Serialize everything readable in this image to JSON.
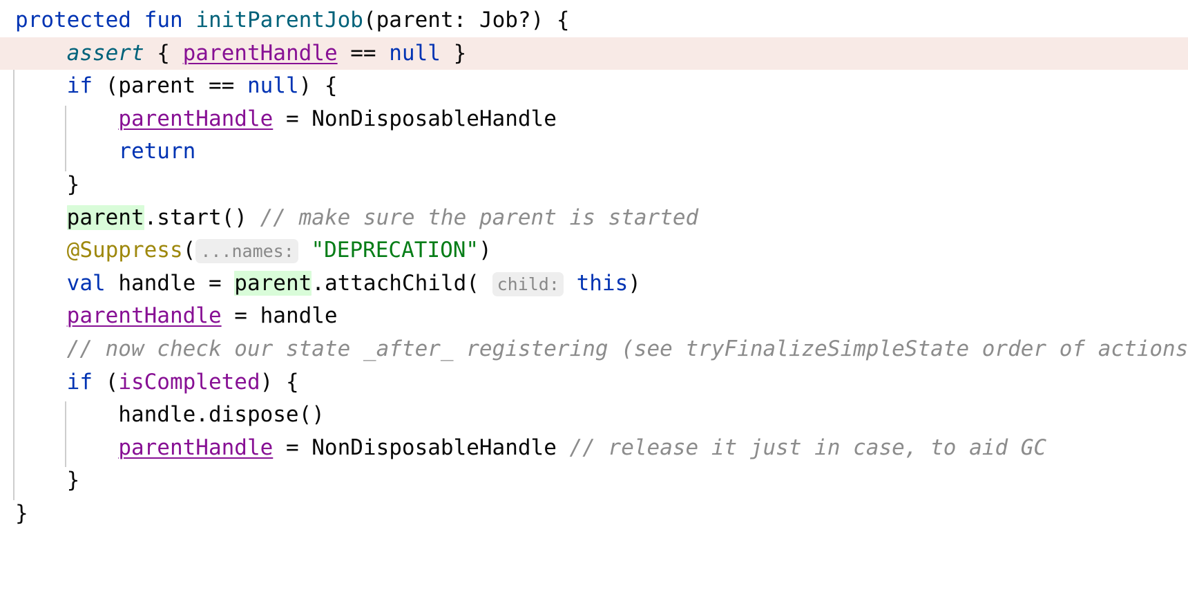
{
  "editor": {
    "language": "Kotlin",
    "theme": "IntelliJ Light",
    "colors": {
      "background": "#ffffff",
      "default_text": "#080808",
      "keyword": "#0033b3",
      "function_declaration": "#00627a",
      "property": "#871094",
      "annotation": "#9e880d",
      "string": "#067d17",
      "comment": "#8c8c8c",
      "usage_highlight": "#d9fcd9",
      "error_line_highlight": "#f8eae6",
      "inlay_hint_text": "#888888",
      "inlay_hint_background": "#eeeeee",
      "indent_guide": "#cdcdcd"
    },
    "lines": [
      {
        "n": 1,
        "text": "protected fun initParentJob(parent: Job?) {",
        "tokens": [
          {
            "t": "protected",
            "c": "kw"
          },
          {
            "t": " ",
            "c": "plain"
          },
          {
            "t": "fun",
            "c": "kw"
          },
          {
            "t": " ",
            "c": "plain"
          },
          {
            "t": "initParentJob",
            "c": "fnname"
          },
          {
            "t": "(parent: Job?) {",
            "c": "plain"
          }
        ]
      },
      {
        "n": 2,
        "text": "    assert { parentHandle == null }",
        "highlight": "error-line",
        "tokens": [
          {
            "t": "    ",
            "c": "plain"
          },
          {
            "t": "assert",
            "c": "contract"
          },
          {
            "t": " { ",
            "c": "plain"
          },
          {
            "t": "parentHandle",
            "c": "field"
          },
          {
            "t": " == ",
            "c": "plain"
          },
          {
            "t": "null",
            "c": "kw"
          },
          {
            "t": " }",
            "c": "plain"
          }
        ]
      },
      {
        "n": 3,
        "text": "    if (parent == null) {",
        "tokens": [
          {
            "t": "    ",
            "c": "plain"
          },
          {
            "t": "if",
            "c": "kw"
          },
          {
            "t": " (parent == ",
            "c": "plain"
          },
          {
            "t": "null",
            "c": "kw"
          },
          {
            "t": ") {",
            "c": "plain"
          }
        ]
      },
      {
        "n": 4,
        "text": "        parentHandle = NonDisposableHandle",
        "tokens": [
          {
            "t": "        ",
            "c": "plain"
          },
          {
            "t": "parentHandle",
            "c": "field"
          },
          {
            "t": " = NonDisposableHandle",
            "c": "plain"
          }
        ]
      },
      {
        "n": 5,
        "text": "        return",
        "tokens": [
          {
            "t": "        ",
            "c": "plain"
          },
          {
            "t": "return",
            "c": "kw"
          }
        ]
      },
      {
        "n": 6,
        "text": "    }",
        "tokens": [
          {
            "t": "    }",
            "c": "plain"
          }
        ]
      },
      {
        "n": 7,
        "text": "    parent.start() // make sure the parent is started",
        "tokens": [
          {
            "t": "    ",
            "c": "plain"
          },
          {
            "t": "parent",
            "c": "plain usage"
          },
          {
            "t": ".start() ",
            "c": "plain"
          },
          {
            "t": "// make sure the parent is started",
            "c": "cmt"
          }
        ]
      },
      {
        "n": 8,
        "text": "    @Suppress( ...names: \"DEPRECATION\")",
        "tokens": [
          {
            "t": "    ",
            "c": "plain"
          },
          {
            "t": "@Suppress",
            "c": "ann"
          },
          {
            "t": "(",
            "c": "plain"
          },
          {
            "t": "...names:",
            "c": "hint"
          },
          {
            "t": " ",
            "c": "plain"
          },
          {
            "t": "\"DEPRECATION\"",
            "c": "str"
          },
          {
            "t": ")",
            "c": "plain"
          }
        ]
      },
      {
        "n": 9,
        "text": "    val handle = parent.attachChild( child: this)",
        "tokens": [
          {
            "t": "    ",
            "c": "plain"
          },
          {
            "t": "val",
            "c": "kw"
          },
          {
            "t": " handle = ",
            "c": "plain"
          },
          {
            "t": "parent",
            "c": "plain usage"
          },
          {
            "t": ".attachChild(",
            "c": "plain"
          },
          {
            "t": " ",
            "c": "plain"
          },
          {
            "t": "child:",
            "c": "hint"
          },
          {
            "t": " ",
            "c": "plain"
          },
          {
            "t": "this",
            "c": "kw"
          },
          {
            "t": ")",
            "c": "plain"
          }
        ]
      },
      {
        "n": 10,
        "text": "    parentHandle = handle",
        "tokens": [
          {
            "t": "    ",
            "c": "plain"
          },
          {
            "t": "parentHandle",
            "c": "field"
          },
          {
            "t": " = handle",
            "c": "plain"
          }
        ]
      },
      {
        "n": 11,
        "text": "    // now check our state _after_ registering (see tryFinalizeSimpleState order of actions)",
        "tokens": [
          {
            "t": "    ",
            "c": "plain"
          },
          {
            "t": "// now check our state _after_ registering (see tryFinalizeSimpleState order of actions)",
            "c": "cmt"
          }
        ]
      },
      {
        "n": 12,
        "text": "    if (isCompleted) {",
        "tokens": [
          {
            "t": "    ",
            "c": "plain"
          },
          {
            "t": "if",
            "c": "kw"
          },
          {
            "t": " (",
            "c": "plain"
          },
          {
            "t": "isCompleted",
            "c": "prop"
          },
          {
            "t": ") {",
            "c": "plain"
          }
        ]
      },
      {
        "n": 13,
        "text": "        handle.dispose()",
        "tokens": [
          {
            "t": "        handle.dispose()",
            "c": "plain"
          }
        ]
      },
      {
        "n": 14,
        "text": "        parentHandle = NonDisposableHandle // release it just in case, to aid GC",
        "tokens": [
          {
            "t": "        ",
            "c": "plain"
          },
          {
            "t": "parentHandle",
            "c": "field"
          },
          {
            "t": " = NonDisposableHandle ",
            "c": "plain"
          },
          {
            "t": "// release it just in case, to aid GC",
            "c": "cmt"
          }
        ]
      },
      {
        "n": 15,
        "text": "    }",
        "tokens": [
          {
            "t": "    }",
            "c": "plain"
          }
        ]
      },
      {
        "n": 16,
        "text": "}",
        "tokens": [
          {
            "t": "}",
            "c": "plain"
          }
        ]
      }
    ],
    "indent_guides": [
      {
        "level": 1,
        "from_line": 2,
        "to_line": 15
      },
      {
        "level": 2,
        "from_line": 4,
        "to_line": 5
      },
      {
        "level": 2,
        "from_line": 13,
        "to_line": 14
      }
    ]
  }
}
